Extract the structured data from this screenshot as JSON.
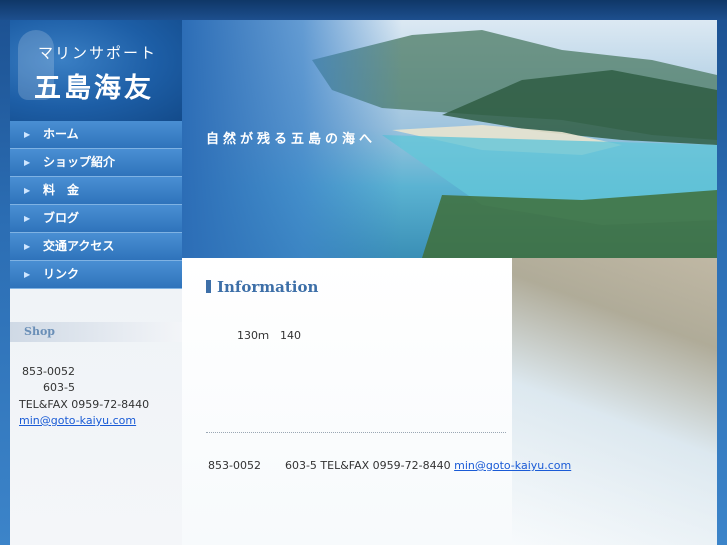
{
  "logo": {
    "subtitle": "マリンサポート",
    "title": "五島海友"
  },
  "nav": {
    "items": [
      {
        "label": "ホーム"
      },
      {
        "label": "ショップ紹介"
      },
      {
        "label": "料　金"
      },
      {
        "label": "ブログ"
      },
      {
        "label": "交通アクセス"
      },
      {
        "label": "リンク"
      }
    ]
  },
  "hero": {
    "caption": "自然が残る五島の海へ"
  },
  "sidebar": {
    "shop_heading": "Shop",
    "postal": "853-0052",
    "address": "603-5",
    "telfax": "TEL&FAX 0959-72-8440",
    "email": "min@goto-kaiyu.com"
  },
  "information": {
    "heading": "Information",
    "text": "130ｍ　140"
  },
  "footer": {
    "postal": "853-0052",
    "address_tel": "603-5 TEL&FAX 0959-72-8440",
    "email": "min@goto-kaiyu.com"
  },
  "colors": {
    "brand_blue": "#2f73bb",
    "link": "#1a5bd6",
    "heading": "#3d6fa8"
  },
  "icons": {
    "nav_bullet": "triangle-right-icon"
  }
}
